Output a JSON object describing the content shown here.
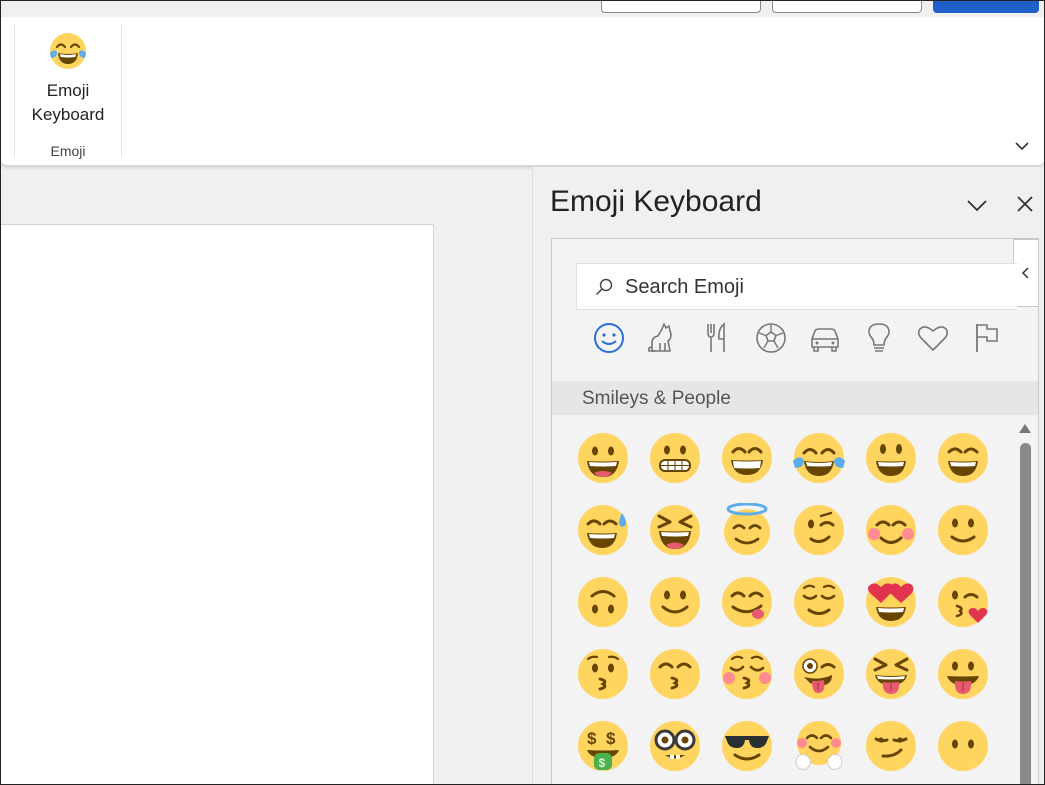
{
  "ribbon": {
    "emoji_keyboard_label_line1": "Emoji",
    "emoji_keyboard_label_line2": "Keyboard",
    "group_label": "Emoji"
  },
  "pane": {
    "title": "Emoji Keyboard",
    "search_placeholder": "Search Emoji",
    "section_title": "Smileys & People",
    "categories": [
      "smileys-icon",
      "animals-icon",
      "food-icon",
      "activity-icon",
      "travel-icon",
      "objects-icon",
      "symbols-icon",
      "flags-icon"
    ],
    "active_category": "smileys-icon"
  },
  "colors": {
    "accent": "#2b6fd6",
    "emoji_face": "#ffd45f",
    "emoji_feature": "#664500",
    "icon_gray": "#777777"
  }
}
